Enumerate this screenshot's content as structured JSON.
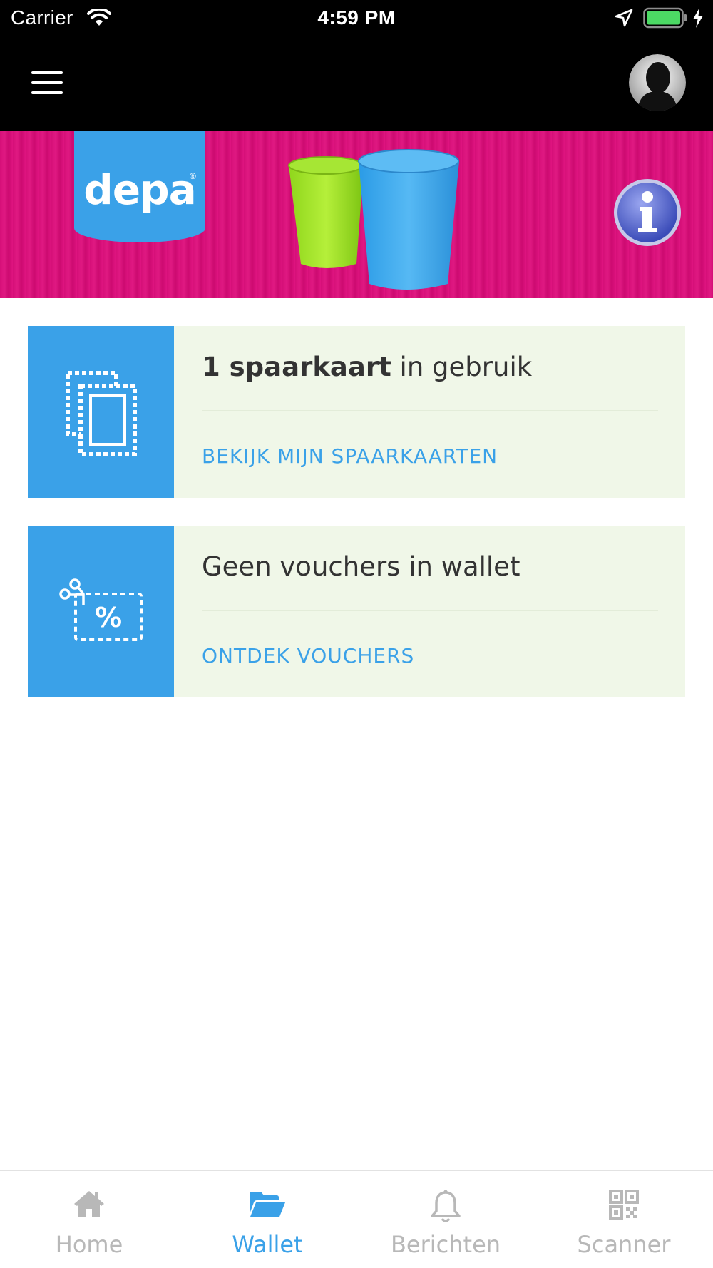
{
  "status_bar": {
    "carrier": "Carrier",
    "time": "4:59 PM",
    "battery_color": "#4cd964"
  },
  "banner": {
    "logo_text": "depa",
    "logo_registered": "®",
    "background_color": "#d50f78",
    "logo_color": "#3aa1e8"
  },
  "cards": [
    {
      "icon": "stamp-cards-icon",
      "title_strong": "1 spaarkaart",
      "title_rest": " in gebruik",
      "link_label": "BEKIJK MIJN SPAARKAARTEN"
    },
    {
      "icon": "voucher-percent-icon",
      "title_strong": "",
      "title_rest": "Geen vouchers in wallet",
      "link_label": "ONTDEK VOUCHERS"
    }
  ],
  "tabs": [
    {
      "label": "Home",
      "icon": "home-icon",
      "active": false
    },
    {
      "label": "Wallet",
      "icon": "folder-open-icon",
      "active": true
    },
    {
      "label": "Berichten",
      "icon": "bell-icon",
      "active": false
    },
    {
      "label": "Scanner",
      "icon": "qr-code-icon",
      "active": false
    }
  ],
  "colors": {
    "accent": "#3aa1e8",
    "card_background": "#f0f7e8",
    "text": "#333333",
    "tab_inactive": "#b8b8b8"
  }
}
